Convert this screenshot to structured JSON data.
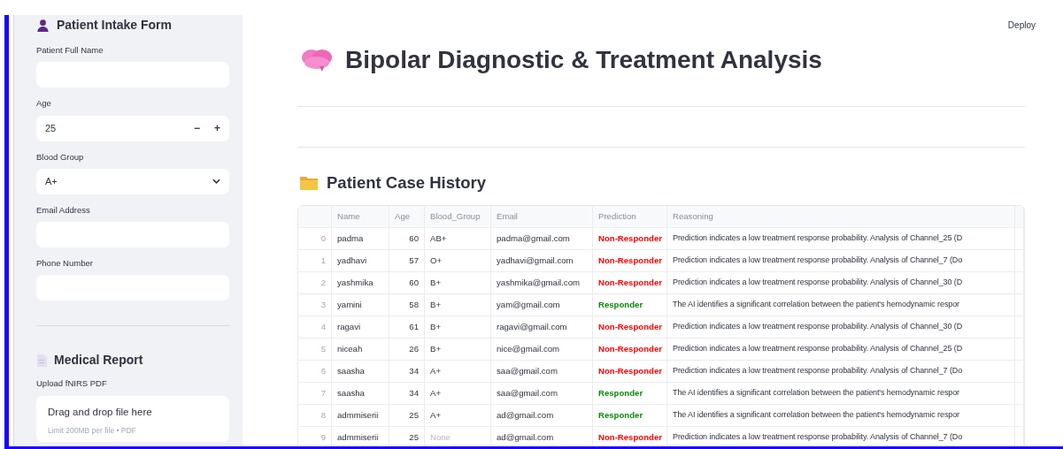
{
  "sidebar": {
    "title": "Patient Intake Form",
    "fields": [
      {
        "kind": "text",
        "label": "Patient Full Name"
      },
      {
        "kind": "number",
        "label": "Age",
        "value": "25",
        "minus": "−",
        "plus": "+"
      },
      {
        "kind": "select",
        "label": "Blood Group",
        "value": "A+"
      },
      {
        "kind": "text",
        "label": "Email Address"
      },
      {
        "kind": "text",
        "label": "Phone Number"
      }
    ],
    "report": {
      "title": "Medical Report",
      "upload_label": "Upload fNIRS PDF",
      "drop_text": "Drag and drop file here",
      "limit_text": "Limit 200MB per file • PDF"
    }
  },
  "toolbar": {
    "deploy": "Deploy"
  },
  "main": {
    "title": "Bipolar Diagnostic & Treatment Analysis",
    "section_title": "Patient Case History"
  },
  "table": {
    "columns": [
      "Name",
      "Age",
      "Blood_Group",
      "Email",
      "Prediction",
      "Reasoning"
    ],
    "rows": [
      {
        "index": "0",
        "name": "padma",
        "age": "60",
        "blood_group": "AB+",
        "blood_group_null": false,
        "email": "padma@gmail.com",
        "prediction": "Non-Responder",
        "kind": "non-responder",
        "reasoning": "Prediction indicates a low treatment response probability. Analysis of Channel_25 (D"
      },
      {
        "index": "1",
        "name": "yadhavi",
        "age": "57",
        "blood_group": "O+",
        "blood_group_null": false,
        "email": "yadhavi@gmail.com",
        "prediction": "Non-Responder",
        "kind": "non-responder",
        "reasoning": "Prediction indicates a low treatment response probability. Analysis of Channel_7 (Do"
      },
      {
        "index": "2",
        "name": "yashmika",
        "age": "60",
        "blood_group": "B+",
        "blood_group_null": false,
        "email": "yashmika@gmail.com",
        "prediction": "Non-Responder",
        "kind": "non-responder",
        "reasoning": "Prediction indicates a low treatment response probability. Analysis of Channel_30 (D"
      },
      {
        "index": "3",
        "name": "yamini",
        "age": "58",
        "blood_group": "B+",
        "blood_group_null": false,
        "email": "yam@gmail.com",
        "prediction": "Responder",
        "kind": "responder",
        "reasoning": "The AI identifies a significant correlation between the patient's hemodynamic respor"
      },
      {
        "index": "4",
        "name": "ragavi",
        "age": "61",
        "blood_group": "B+",
        "blood_group_null": false,
        "email": "ragavi@gmail.com",
        "prediction": "Non-Responder",
        "kind": "non-responder",
        "reasoning": "Prediction indicates a low treatment response probability. Analysis of Channel_30 (D"
      },
      {
        "index": "5",
        "name": "niceah",
        "age": "26",
        "blood_group": "B+",
        "blood_group_null": false,
        "email": "nice@gmail.com",
        "prediction": "Non-Responder",
        "kind": "non-responder",
        "reasoning": "Prediction indicates a low treatment response probability. Analysis of Channel_25 (D"
      },
      {
        "index": "6",
        "name": "saasha",
        "age": "34",
        "blood_group": "A+",
        "blood_group_null": false,
        "email": "saa@gmail.com",
        "prediction": "Non-Responder",
        "kind": "non-responder",
        "reasoning": "Prediction indicates a low treatment response probability. Analysis of Channel_7 (Do"
      },
      {
        "index": "7",
        "name": "saasha",
        "age": "34",
        "blood_group": "A+",
        "blood_group_null": false,
        "email": "saa@gmail.com",
        "prediction": "Responder",
        "kind": "responder",
        "reasoning": "The AI identifies a significant correlation between the patient's hemodynamic respor"
      },
      {
        "index": "8",
        "name": "admmiserii",
        "age": "25",
        "blood_group": "A+",
        "blood_group_null": false,
        "email": "ad@gmail.com",
        "prediction": "Responder",
        "kind": "responder",
        "reasoning": "The AI identifies a significant correlation between the patient's hemodynamic respor"
      },
      {
        "index": "9",
        "name": "admmiserii",
        "age": "25",
        "blood_group": "None",
        "blood_group_null": true,
        "email": "ad@gmail.com",
        "prediction": "Non-Responder",
        "kind": "non-responder",
        "reasoning": "Prediction indicates a low treatment response probability. Analysis of Channel_7 (Do"
      }
    ]
  }
}
